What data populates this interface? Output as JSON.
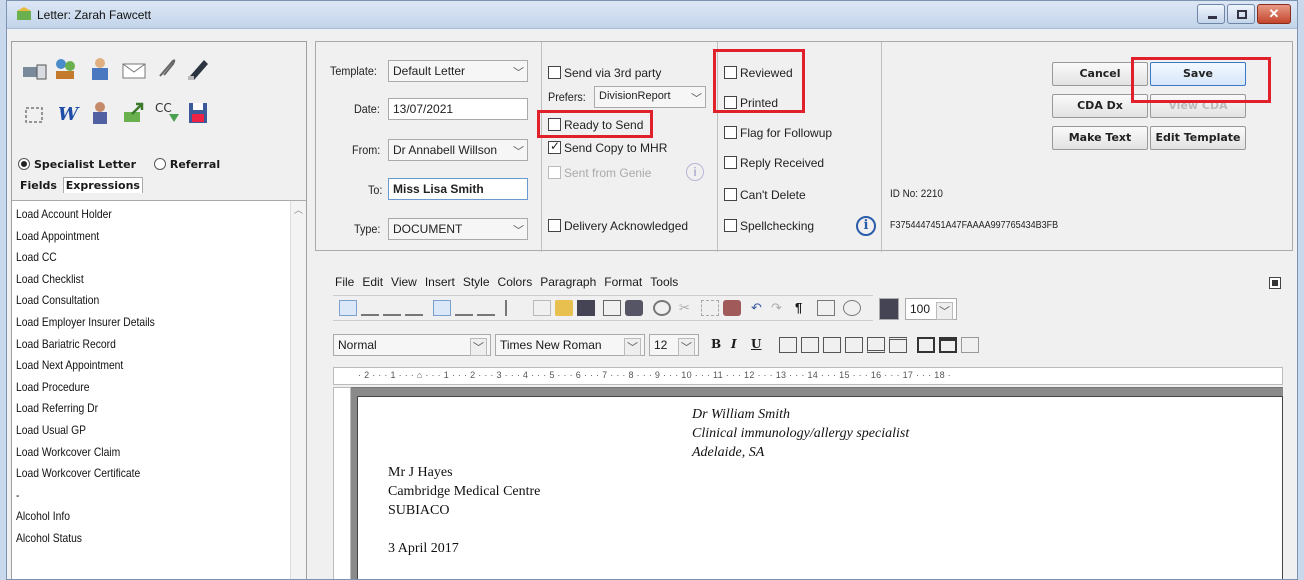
{
  "window": {
    "title": "Letter: Zarah Fawcett"
  },
  "left": {
    "radio_specialist": "Specialist Letter",
    "radio_referral": "Referral",
    "tab_fields": "Fields",
    "tab_expressions": "Expressions",
    "expressions": [
      "Load Account Holder",
      "Load Appointment",
      "Load CC",
      "Load Checklist",
      "Load Consultation",
      "Load Employer Insurer Details",
      "Load Bariatric Record",
      "Load Next Appointment",
      "Load Procedure",
      "Load Referring Dr",
      "Load Usual GP",
      "Load Workcover Claim",
      "Load Workcover Certificate",
      "-",
      "Alcohol Info",
      "Alcohol Status"
    ]
  },
  "form": {
    "template_label": "Template:",
    "template_value": "Default Letter",
    "date_label": "Date:",
    "date_value": "13/07/2021",
    "from_label": "From:",
    "from_value": "Dr Annabell Willson",
    "to_label": "To:",
    "to_value": "Miss Lisa Smith",
    "type_label": "Type:",
    "type_value": "DOCUMENT"
  },
  "send": {
    "via_3rd": "Send via 3rd party",
    "prefers_label": "Prefers:",
    "prefers_value": "DivisionReport",
    "ready": "Ready to Send",
    "copy_mhr": "Send Copy to MHR",
    "sent_genie": "Sent from Genie",
    "delivery": "Delivery Acknowledged"
  },
  "status": {
    "reviewed": "Reviewed",
    "printed": "Printed",
    "flag": "Flag for Followup",
    "reply": "Reply Received",
    "cant_delete": "Can't Delete",
    "spell": "Spellchecking"
  },
  "ids": {
    "id_no": "ID No: 2210",
    "hash": "F3754447451A47FAAAA997765434B3FB"
  },
  "buttons": {
    "cancel": "Cancel",
    "save": "Save",
    "cda": "CDA Dx",
    "view_cda": "View CDA",
    "make_text": "Make Text",
    "edit_template": "Edit Template"
  },
  "editor": {
    "menus": [
      "File",
      "Edit",
      "View",
      "Insert",
      "Style",
      "Colors",
      "Paragraph",
      "Format",
      "Tools"
    ],
    "style": "Normal",
    "font": "Times New Roman",
    "size": "12",
    "zoom": "100",
    "ruler": "· 2 · · · 1 · · · ⌂ · · · 1 · · · 2 · · · 3 · · · 4 · · · 5 · · · 6 · · · 7 · · · 8 · · · 9 · · · 10 · · · 11 · · · 12 · · · 13 · · · 14 · · · 15 · · · 16 · · · 17 · · · 18 ·"
  },
  "doc": {
    "sender_name": "Dr William Smith",
    "sender_title": "Clinical immunology/allergy specialist",
    "sender_city": "Adelaide, SA",
    "recip_name": "Mr J Hayes",
    "recip_org": "Cambridge Medical Centre",
    "recip_city": "SUBIACO",
    "date": "3 April 2017"
  },
  "colors": {
    "highlight": "#e0202a",
    "accent": "#2a5caa"
  }
}
